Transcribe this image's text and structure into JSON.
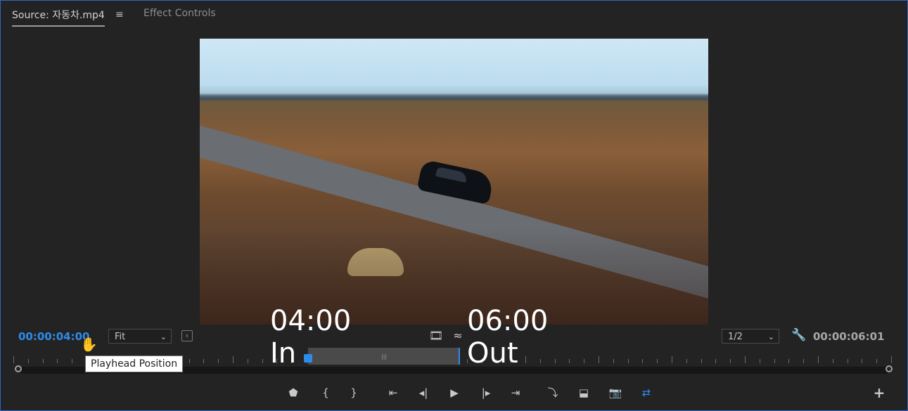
{
  "tabs": {
    "source": "Source: 자동차.mp4",
    "menu_glyph": "≡",
    "effect_controls": "Effect Controls"
  },
  "overlay": {
    "in_time": "04:00",
    "in_label": "In",
    "out_time": "06:00",
    "out_label": "Out"
  },
  "controls": {
    "playhead_timecode": "00:00:04:00",
    "zoom_value": "Fit",
    "resolution_value": "1/2",
    "duration_timecode": "00:00:06:01",
    "tooltip": "Playhead Position"
  },
  "icons": {
    "safe_margin": "safe-margins-icon",
    "film": "film-icon",
    "wave": "drag-audio-icon",
    "wrench": "settings-wrench-icon",
    "cursor": "hand-cursor-icon"
  },
  "colors": {
    "accent": "#2d8ceb",
    "panel_border": "#2f64c7"
  },
  "transport_buttons": [
    {
      "name": "add-marker-button",
      "glyph": "⬟"
    },
    {
      "name": "mark-in-button",
      "glyph": "{"
    },
    {
      "name": "mark-out-button",
      "glyph": "}"
    },
    {
      "name": "go-to-in-button",
      "glyph": "⇤"
    },
    {
      "name": "step-back-button",
      "glyph": "◂|"
    },
    {
      "name": "play-button",
      "glyph": "▶"
    },
    {
      "name": "step-forward-button",
      "glyph": "|▸"
    },
    {
      "name": "go-to-out-button",
      "glyph": "⇥"
    },
    {
      "name": "insert-button",
      "glyph": "⤵"
    },
    {
      "name": "overwrite-button",
      "glyph": "⬓"
    },
    {
      "name": "export-frame-button",
      "glyph": "📷"
    },
    {
      "name": "toggle-proxies-button",
      "glyph": "⇄"
    }
  ],
  "add_button_glyph": "+"
}
